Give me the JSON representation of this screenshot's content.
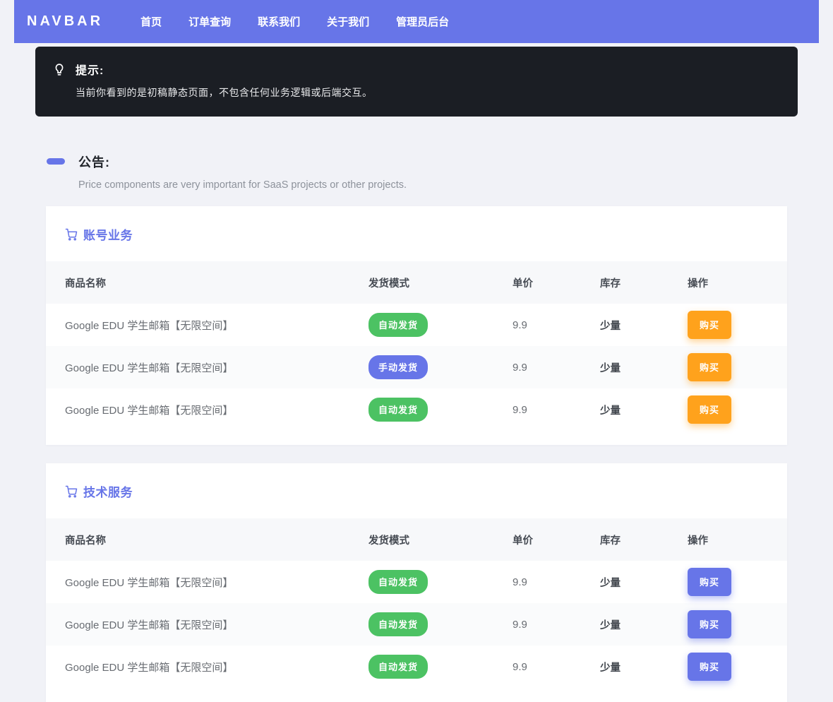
{
  "navbar": {
    "brand": "NAVBAR",
    "items": [
      {
        "label": "首页"
      },
      {
        "label": "订单查询"
      },
      {
        "label": "联系我们"
      },
      {
        "label": "关于我们"
      },
      {
        "label": "管理员后台"
      }
    ]
  },
  "tip": {
    "title": "提示:",
    "body": "当前你看到的是初稿静态页面，不包含任何业务逻辑或后端交互。"
  },
  "announcement": {
    "title": "公告:",
    "body": "Price components are very important for SaaS projects or other projects."
  },
  "tables": [
    {
      "title": "账号业务",
      "columns": [
        "商品名称",
        "发货模式",
        "单价",
        "库存",
        "操作"
      ],
      "buy_class": "btn-orange",
      "rows": [
        {
          "name": "Google EDU 学生邮箱【无限空间】",
          "mode": "自动发货",
          "mode_class": "badge-green",
          "price": "9.9",
          "stock": "少量",
          "action": "购买"
        },
        {
          "name": "Google EDU 学生邮箱【无限空间】",
          "mode": "手动发货",
          "mode_class": "badge-purple",
          "price": "9.9",
          "stock": "少量",
          "action": "购买"
        },
        {
          "name": "Google EDU 学生邮箱【无限空间】",
          "mode": "自动发货",
          "mode_class": "badge-green",
          "price": "9.9",
          "stock": "少量",
          "action": "购买"
        }
      ]
    },
    {
      "title": "技术服务",
      "columns": [
        "商品名称",
        "发货模式",
        "单价",
        "库存",
        "操作"
      ],
      "buy_class": "btn-purple",
      "rows": [
        {
          "name": "Google EDU 学生邮箱【无限空间】",
          "mode": "自动发货",
          "mode_class": "badge-green",
          "price": "9.9",
          "stock": "少量",
          "action": "购买"
        },
        {
          "name": "Google EDU 学生邮箱【无限空间】",
          "mode": "自动发货",
          "mode_class": "badge-green",
          "price": "9.9",
          "stock": "少量",
          "action": "购买"
        },
        {
          "name": "Google EDU 学生邮箱【无限空间】",
          "mode": "自动发货",
          "mode_class": "badge-green",
          "price": "9.9",
          "stock": "少量",
          "action": "购买"
        }
      ]
    }
  ],
  "colors": {
    "primary": "#6775e8",
    "badge_green": "#4cc263",
    "buy_orange": "#ffa21c",
    "tip_background": "#1b1e24",
    "page_background": "#f1f2f7"
  }
}
